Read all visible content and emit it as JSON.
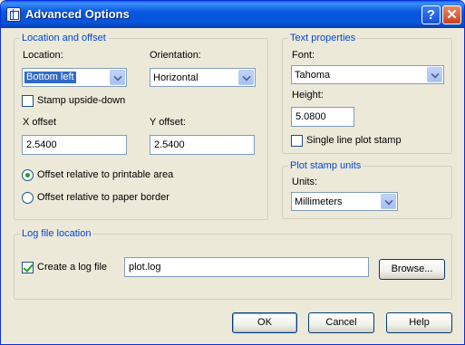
{
  "window": {
    "title": "Advanced Options"
  },
  "location_group": {
    "legend": "Location and offset",
    "location_label": "Location:",
    "location_value": "Bottom left",
    "orientation_label": "Orientation:",
    "orientation_value": "Horizontal",
    "stamp_upside_down_label": "Stamp upside-down",
    "stamp_upside_down_checked": false,
    "x_offset_label": "X offset",
    "x_offset_value": "2.5400",
    "y_offset_label": "Y offset:",
    "y_offset_value": "2.5400",
    "radio_printable_label": "Offset relative to printable area",
    "radio_printable_selected": true,
    "radio_paper_label": "Offset relative to paper border",
    "radio_paper_selected": false
  },
  "text_group": {
    "legend": "Text properties",
    "font_label": "Font:",
    "font_value": "Tahoma",
    "height_label": "Height:",
    "height_value": "5.0800",
    "single_line_label": "Single line plot stamp",
    "single_line_checked": false
  },
  "units_group": {
    "legend": "Plot stamp units",
    "units_label": "Units:",
    "units_value": "Millimeters"
  },
  "log_group": {
    "legend": "Log file location",
    "create_log_label": "Create a log file",
    "create_log_checked": true,
    "log_path_value": "plot.log",
    "browse_label": "Browse..."
  },
  "buttons": {
    "ok": "OK",
    "cancel": "Cancel",
    "help": "Help"
  }
}
